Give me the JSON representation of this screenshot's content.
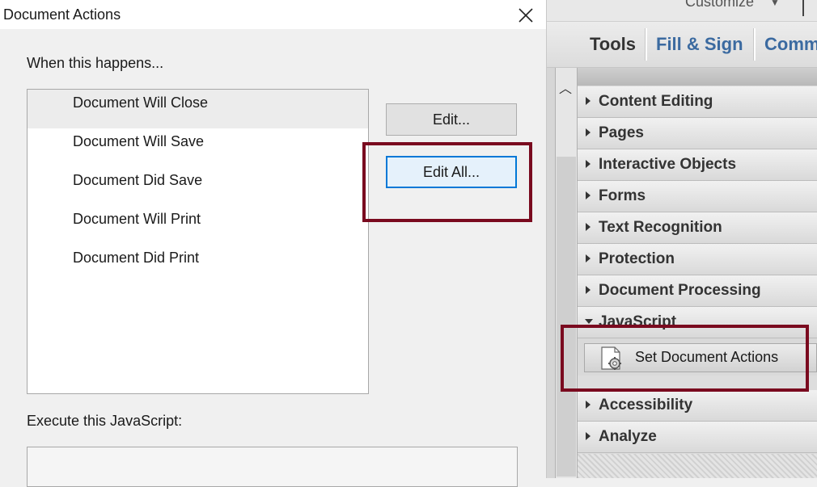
{
  "dialog": {
    "title": "Document Actions",
    "when_label": "When this happens...",
    "events": [
      {
        "label": "Document Will Close",
        "selected": true
      },
      {
        "label": "Document Will Save",
        "selected": false
      },
      {
        "label": "Document Did Save",
        "selected": false
      },
      {
        "label": "Document Will Print",
        "selected": false
      },
      {
        "label": "Document Did Print",
        "selected": false
      }
    ],
    "edit_button": "Edit...",
    "edit_all_button": "Edit All...",
    "execute_label": "Execute this JavaScript:",
    "highlight_color": "#7a0a1f"
  },
  "right_pane": {
    "customize": "Customize",
    "tabs": [
      "Tools",
      "Fill & Sign",
      "Comm"
    ],
    "sections": [
      "Content Editing",
      "Pages",
      "Interactive Objects",
      "Forms",
      "Text Recognition",
      "Protection",
      "Document Processing",
      "JavaScript",
      "Accessibility",
      "Analyze"
    ],
    "javascript_tool": "Set Document Actions"
  }
}
